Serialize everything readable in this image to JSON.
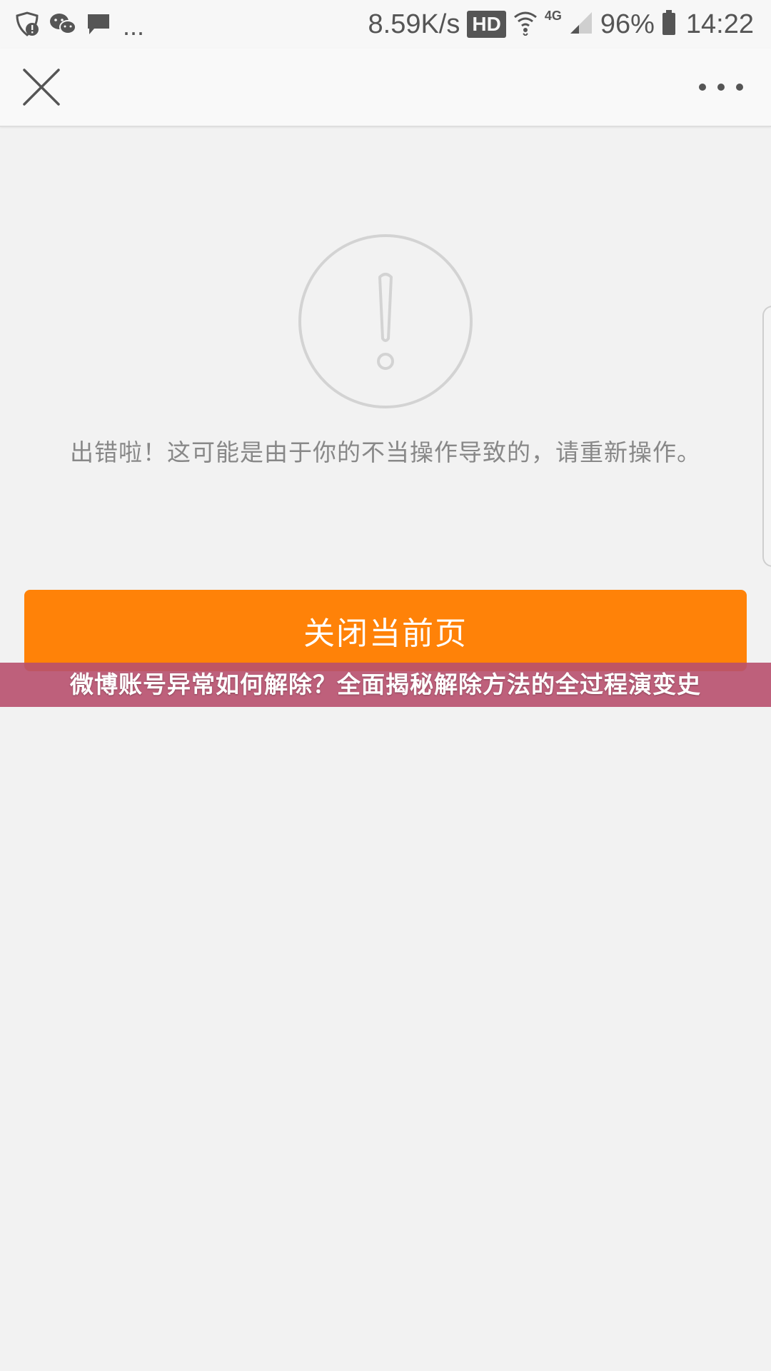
{
  "status_bar": {
    "notification_icons": [
      "shield-alert-icon",
      "wechat-icon",
      "chat-bubble-icon"
    ],
    "more_notifications": "...",
    "net_speed": "8.59K/s",
    "hd_badge": "HD",
    "net_type": "4G",
    "battery": "96%",
    "time": "14:22"
  },
  "nav": {
    "close_icon": "close-icon",
    "more_icon": "more-horizontal-icon"
  },
  "error": {
    "icon": "exclamation-circle-icon",
    "message": "出错啦！这可能是由于你的不当操作导致的，请重新操作。"
  },
  "actions": {
    "close_page_label": "关闭当前页"
  },
  "banner": {
    "headline": "微博账号异常如何解除？全面揭秘解除方法的全过程演变史"
  },
  "colors": {
    "accent": "#ff8208",
    "background": "#f2f2f2",
    "banner": "#b8506e"
  }
}
